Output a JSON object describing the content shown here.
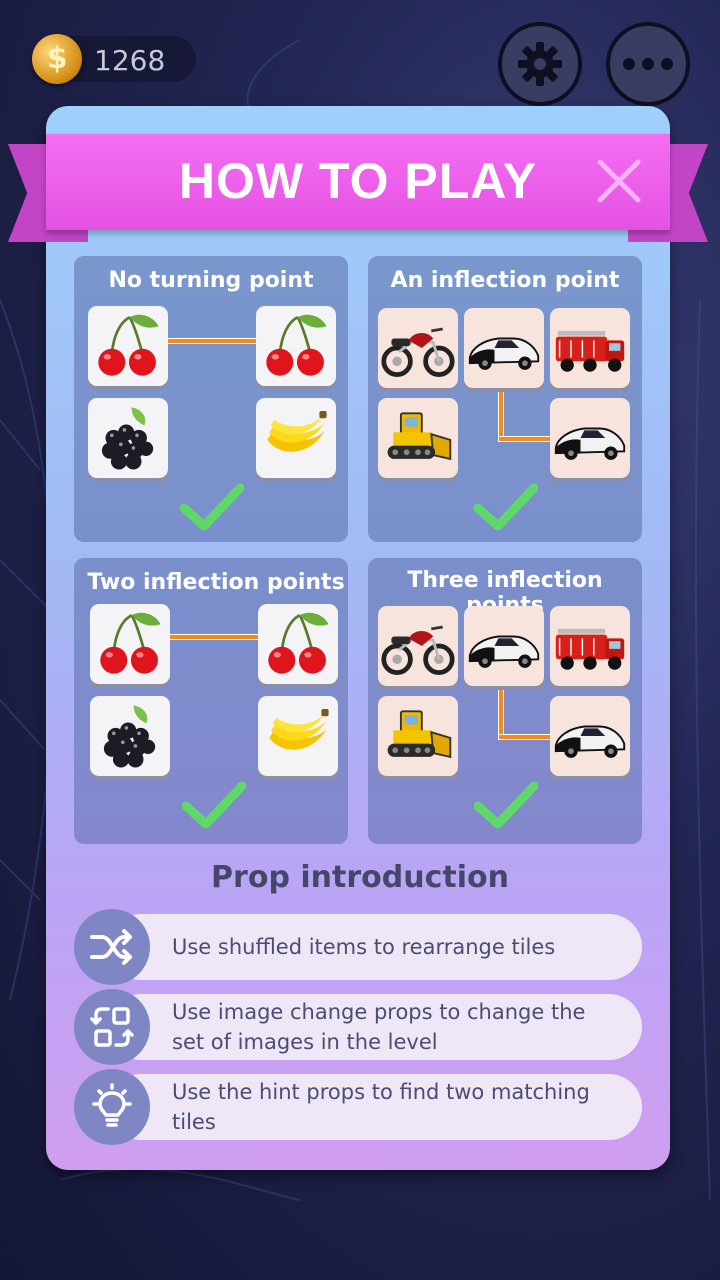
{
  "hud": {
    "coins": "1268",
    "coin_symbol": "$"
  },
  "dialog": {
    "title": "HOW TO PLAY",
    "examples": [
      {
        "title": "No turning point"
      },
      {
        "title": "An inflection point"
      },
      {
        "title": "Two inflection points"
      },
      {
        "title": "Three inflection points"
      }
    ],
    "tile_icons": [
      "cherry-icon",
      "blackberry-icon",
      "banana-icon",
      "motorcycle-icon",
      "sports-car-icon",
      "fire-truck-icon",
      "bulldozer-icon"
    ],
    "props_title": "Prop introduction",
    "props": [
      {
        "icon": "shuffle-icon",
        "text": "Use shuffled items to rearrange tiles"
      },
      {
        "icon": "image-change-icon",
        "text": "Use image change props to change the set of images in the level"
      },
      {
        "icon": "hint-bulb-icon",
        "text": "Use the hint props to find two matching tiles"
      }
    ]
  },
  "colors": {
    "ribbon": "#e552e3",
    "link": "#f28a1c",
    "check": "#5fd86a",
    "prop_icon_bg": "#7e87c4"
  }
}
